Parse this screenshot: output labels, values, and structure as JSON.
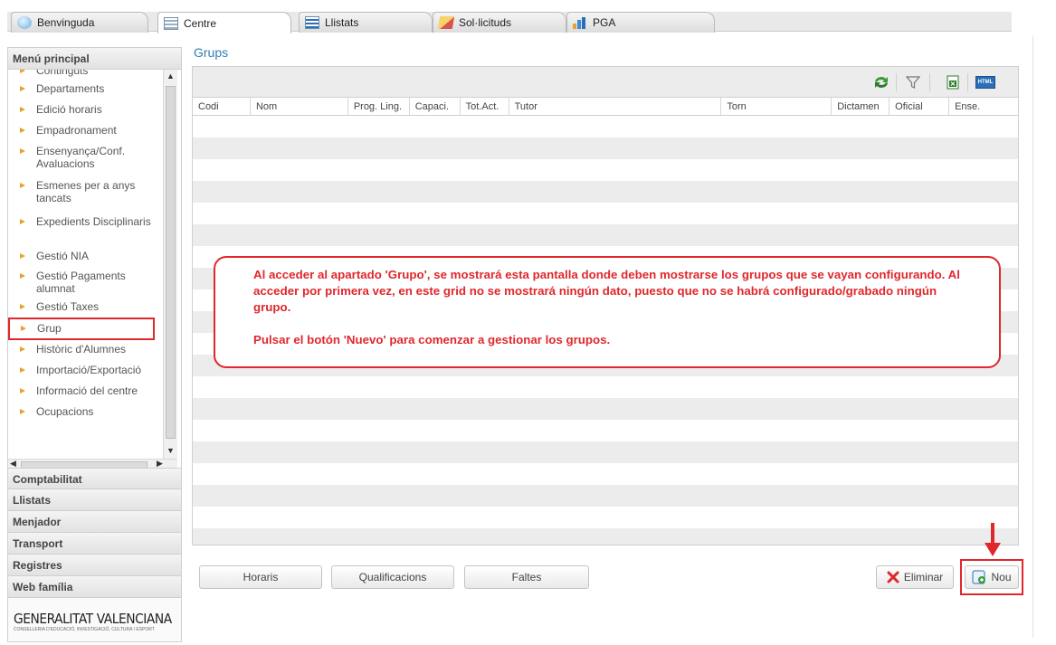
{
  "tabs": [
    {
      "label": "Benvinguda",
      "icon": "welcome-icon"
    },
    {
      "label": "Centre",
      "icon": "grid-icon",
      "active": true
    },
    {
      "label": "Llistats",
      "icon": "list-icon"
    },
    {
      "label": "Sol·licituds",
      "icon": "pencil-icon"
    },
    {
      "label": "PGA",
      "icon": "chart-icon"
    }
  ],
  "sidebar": {
    "main_menu_title": "Menú principal",
    "items": [
      "Continguts",
      "Departaments",
      "Edició horaris",
      "Empadronament",
      "Ensenyança/Conf. Avaluacions",
      "Esmenes per a anys tancats",
      "Expedients Disciplinaris",
      "Gestió NIA",
      "Gestió Pagaments alumnat",
      "Gestió Taxes",
      "Grup",
      "Històric d'Alumnes",
      "Importació/Exportació",
      "Informació del centre",
      "Ocupacions"
    ],
    "selected_item": "Grup",
    "sections": [
      "Comptabilitat",
      "Llistats",
      "Menjador",
      "Transport",
      "Registres",
      "Web família"
    ],
    "logo_text": "GENERALITAT VALENCIANA",
    "logo_subtext": "CONSELLERIA D'EDUCACIÓ, INVESTIGACIÓ, CULTURA I ESPORT"
  },
  "main": {
    "title": "Grups",
    "columns": [
      "Codi",
      "Nom",
      "Prog. Ling.",
      "Capaci.",
      "Tot.Act.",
      "Tutor",
      "Torn",
      "Dictamen",
      "Oficial",
      "Ense."
    ],
    "toolbar_icons": [
      "refresh-icon",
      "filter-icon",
      "excel-export-icon",
      "html-export-icon"
    ],
    "html_badge": "HTML"
  },
  "callout": {
    "line1": "Al acceder al apartado 'Grupo', se mostrará esta pantalla donde deben mostrarse los grupos que se vayan configurando. Al acceder por primera vez, en este grid no se mostrará ningún dato, puesto que no se habrá configurado/grabado ningún grupo.",
    "line2": "Pulsar el botón 'Nuevo' para comenzar a gestionar los grupos."
  },
  "buttons": {
    "horaris": "Horaris",
    "qualificacions": "Qualificacions",
    "faltes": "Faltes",
    "eliminar": "Eliminar",
    "nou": "Nou"
  },
  "colors": {
    "accent_red": "#e0272c",
    "title_blue": "#2f7fb3",
    "bullet_orange": "#e8a12f"
  }
}
